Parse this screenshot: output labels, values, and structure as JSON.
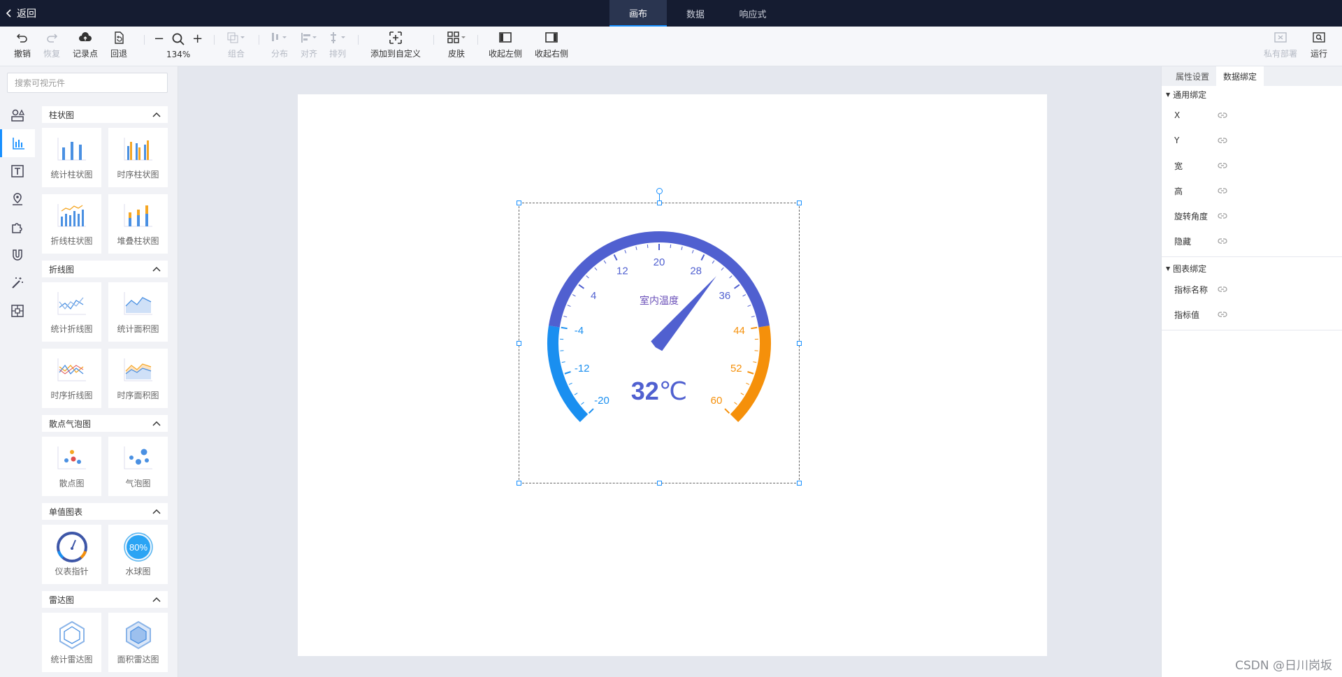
{
  "topbar": {
    "back_label": "返回",
    "tabs": [
      {
        "label": "画布",
        "active": true
      },
      {
        "label": "数据",
        "active": false
      },
      {
        "label": "响应式",
        "active": false
      }
    ]
  },
  "toolbar": {
    "undo": "撤销",
    "redo": "恢复",
    "checkpoint": "记录点",
    "rollback": "回退",
    "zoom_minus": "−",
    "zoom_plus": "+",
    "zoom_level": "134%",
    "group": "组合",
    "distribute": "分布",
    "align": "对齐",
    "arrange": "排列",
    "add_custom": "添加到自定义",
    "skin": "皮肤",
    "collapse_left": "收起左侧",
    "collapse_right": "收起右侧",
    "private_deploy": "私有部署",
    "run": "运行"
  },
  "left": {
    "search_placeholder": "搜索可视元件",
    "rail_icons": [
      "shapes-icon",
      "bar-chart-icon",
      "text-icon",
      "map-pin-icon",
      "puzzle-icon",
      "magnet-icon",
      "magic-wand-icon",
      "layout-icon"
    ],
    "groups": [
      {
        "title": "柱状图",
        "items": [
          {
            "name": "统计柱状图",
            "icon": "bar-stat-icon"
          },
          {
            "name": "时序柱状图",
            "icon": "bar-time-icon"
          },
          {
            "name": "折线柱状图",
            "icon": "bar-line-icon"
          },
          {
            "name": "堆叠柱状图",
            "icon": "bar-stack-icon"
          }
        ]
      },
      {
        "title": "折线图",
        "items": [
          {
            "name": "统计折线图",
            "icon": "line-stat-icon"
          },
          {
            "name": "统计面积图",
            "icon": "area-stat-icon"
          },
          {
            "name": "时序折线图",
            "icon": "line-time-icon"
          },
          {
            "name": "时序面积图",
            "icon": "area-time-icon"
          }
        ]
      },
      {
        "title": "散点气泡图",
        "items": [
          {
            "name": "散点图",
            "icon": "scatter-icon"
          },
          {
            "name": "气泡图",
            "icon": "bubble-icon"
          }
        ]
      },
      {
        "title": "单值图表",
        "items": [
          {
            "name": "仪表指针",
            "icon": "gauge-icon"
          },
          {
            "name": "水球图",
            "icon": "liquid-icon",
            "badge": "80%"
          }
        ]
      },
      {
        "title": "雷达图",
        "items": [
          {
            "name": "统计雷达图",
            "icon": "radar-stat-icon"
          },
          {
            "name": "面积雷达图",
            "icon": "radar-area-icon"
          }
        ]
      }
    ]
  },
  "gauge": {
    "title": "室内温度",
    "value": 32,
    "unit": "℃",
    "min": -20,
    "max": 60,
    "ticks": [
      "-20",
      "-12",
      "-4",
      "4",
      "12",
      "20",
      "28",
      "36",
      "44",
      "52",
      "60"
    ],
    "colors": {
      "low": "#1a8ff0",
      "mid": "#5060d0",
      "high": "#f5900a"
    },
    "low_end": -4,
    "high_start": 44
  },
  "right": {
    "tabs": [
      {
        "label": "属性设置",
        "active": false
      },
      {
        "label": "数据绑定",
        "active": true
      }
    ],
    "general_title": "通用绑定",
    "general_rows": [
      "X",
      "Y",
      "宽",
      "高",
      "旋转角度",
      "隐藏"
    ],
    "chart_title": "图表绑定",
    "chart_rows": [
      "指标名称",
      "指标值"
    ]
  },
  "watermark": "CSDN @日川岗坂"
}
